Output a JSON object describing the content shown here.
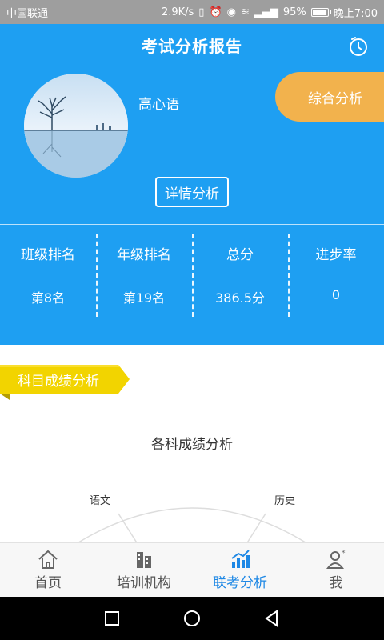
{
  "status_bar": {
    "carrier": "中国联通",
    "speed": "2.9K/s",
    "network": "4G",
    "battery": "95%",
    "time": "晚上7:00"
  },
  "header": {
    "title": "考试分析报告",
    "history_icon": "clock-icon"
  },
  "profile": {
    "name": "高心语",
    "summary_button": "综合分析",
    "detail_button": "详情分析"
  },
  "stats": [
    {
      "label": "班级排名",
      "value": "第8名"
    },
    {
      "label": "年级排名",
      "value": "第19名"
    },
    {
      "label": "总分",
      "value": "386.5分"
    },
    {
      "label": "进步率",
      "value": "0"
    }
  ],
  "section": {
    "ribbon_label": "科目成绩分析",
    "chart_title": "各科成绩分析",
    "radar_labels": [
      "语文",
      "历史"
    ]
  },
  "bottom_nav": [
    {
      "label": "首页",
      "icon": "home-icon"
    },
    {
      "label": "培训机构",
      "icon": "building-icon"
    },
    {
      "label": "联考分析",
      "icon": "chart-icon"
    },
    {
      "label": "我",
      "icon": "user-icon"
    }
  ],
  "colors": {
    "primary": "#1e9ff2",
    "accent": "#f2b24d",
    "ribbon": "#f2d400",
    "nav_active": "#1e88e5"
  }
}
